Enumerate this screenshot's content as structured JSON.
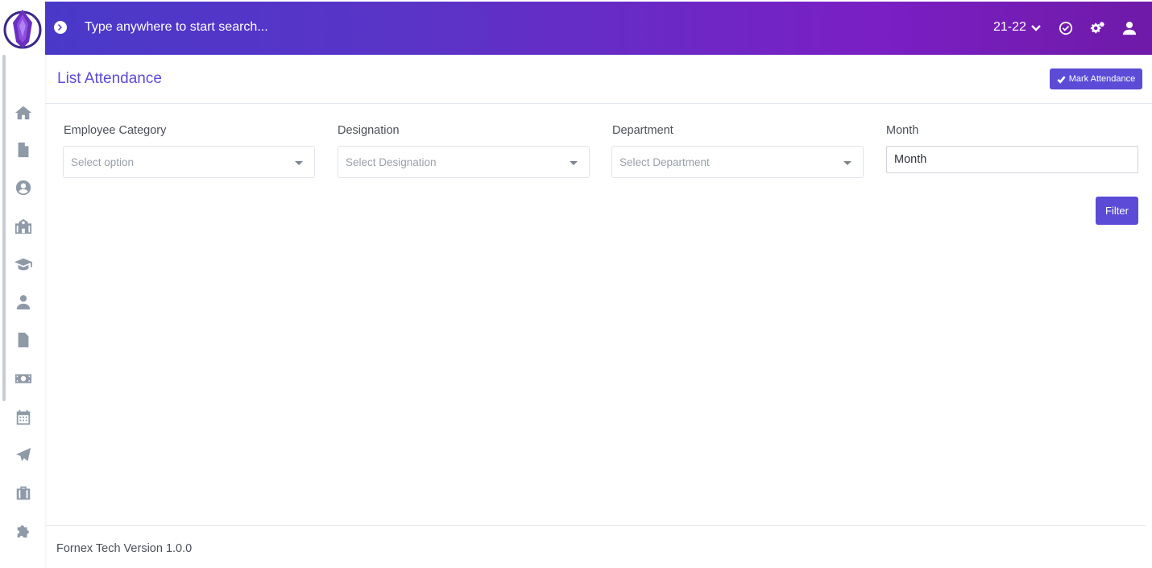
{
  "topbar": {
    "search_placeholder": "Type anywhere to start search...",
    "year_label": "21-22",
    "icons": [
      "arrow-circle-right-icon",
      "chevron-down-icon",
      "check-circle-icon",
      "cogs-icon",
      "user-icon"
    ]
  },
  "sidebar": {
    "items": [
      {
        "icon": "home-icon"
      },
      {
        "icon": "file-icon"
      },
      {
        "icon": "user-circle-icon"
      },
      {
        "icon": "school-icon"
      },
      {
        "icon": "graduation-cap-icon"
      },
      {
        "icon": "user-tie-icon"
      },
      {
        "icon": "file-alt-icon"
      },
      {
        "icon": "money-bill-icon"
      },
      {
        "icon": "calendar-icon"
      },
      {
        "icon": "paper-plane-icon"
      },
      {
        "icon": "briefcase-icon"
      },
      {
        "icon": "puzzle-piece-icon"
      }
    ]
  },
  "page": {
    "title": "List Attendance",
    "mark_attendance_label": "Mark Attendance"
  },
  "filters": {
    "employee_category": {
      "label": "Employee Category",
      "placeholder": "Select option"
    },
    "designation": {
      "label": "Designation",
      "placeholder": "Select Designation"
    },
    "department": {
      "label": "Department",
      "placeholder": "Select Department"
    },
    "month": {
      "label": "Month",
      "value": "Month"
    },
    "filter_label": "Filter"
  },
  "footer": {
    "text": "Fornex Tech Version 1.0.0"
  },
  "colors": {
    "accent": "#5b4bd6",
    "topbar_start": "#4a39c9",
    "topbar_end": "#7a1fc4",
    "sidebar_icon": "#8f9aa8"
  }
}
